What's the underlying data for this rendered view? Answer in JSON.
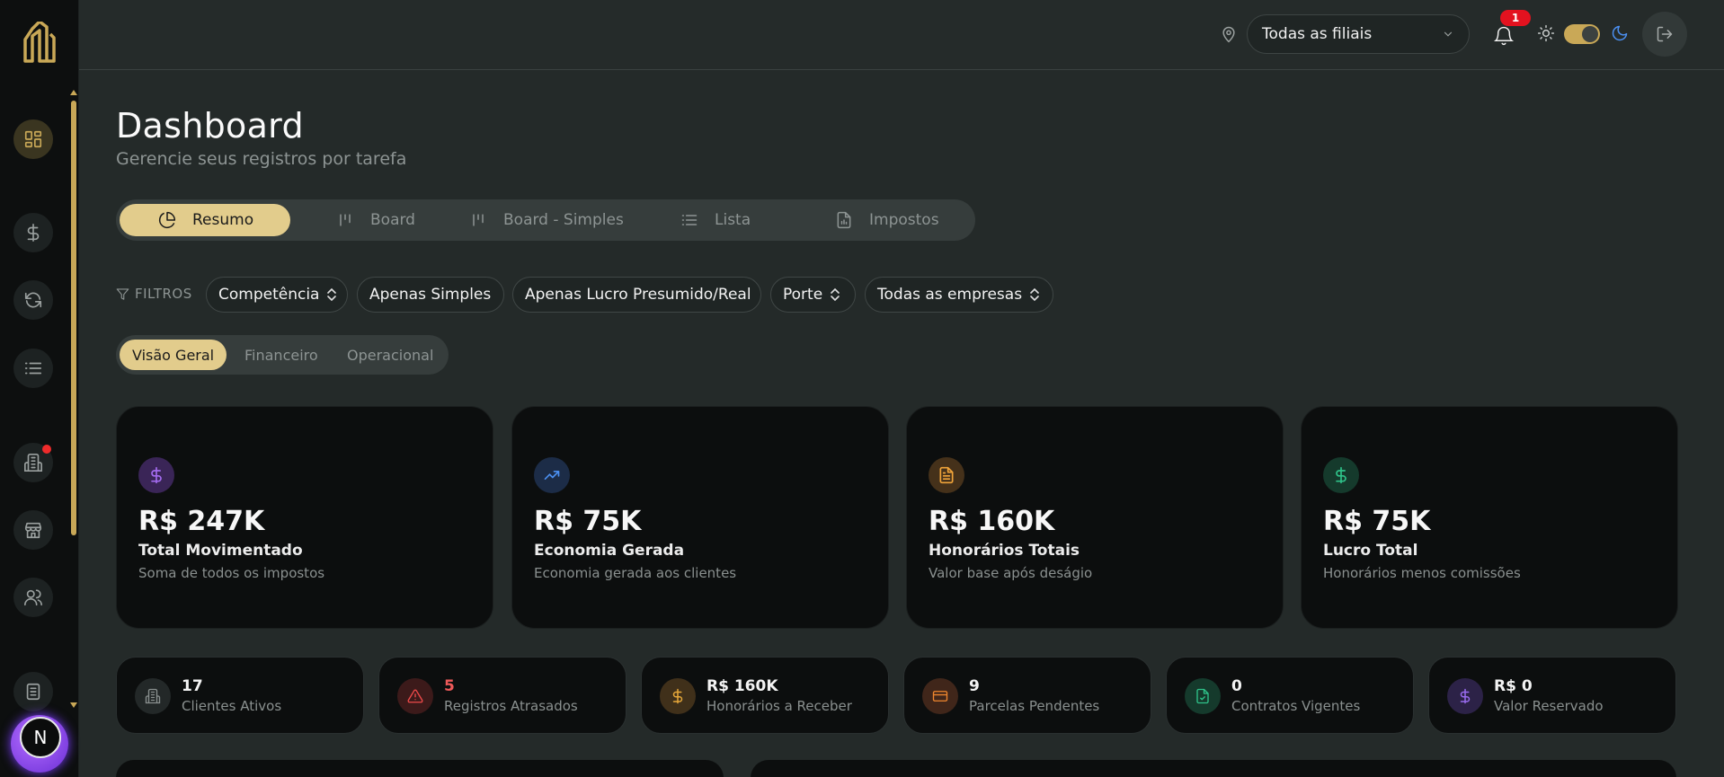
{
  "sidebar": {
    "avatar_initial": "N",
    "items": [
      {
        "name": "dashboard",
        "active": true
      },
      {
        "name": "financeiro"
      },
      {
        "name": "recorrencias"
      },
      {
        "name": "lista"
      },
      {
        "name": "empresas",
        "has_notification": true
      },
      {
        "name": "filiais"
      },
      {
        "name": "usuarios"
      },
      {
        "name": "relatorios"
      }
    ]
  },
  "topbar": {
    "branch_select": "Todas as filiais",
    "notification_count": "1"
  },
  "header": {
    "title": "Dashboard",
    "subtitle": "Gerencie seus registros por tarefa"
  },
  "view_tabs": [
    {
      "label": "Resumo",
      "icon": "pie-chart-icon",
      "active": true
    },
    {
      "label": "Board",
      "icon": "kanban-icon"
    },
    {
      "label": "Board - Simples",
      "icon": "kanban-icon"
    },
    {
      "label": "Lista",
      "icon": "list-icon"
    },
    {
      "label": "Impostos",
      "icon": "document-icon"
    }
  ],
  "filters": {
    "label": "FILTROS",
    "chips": [
      {
        "label": "Competência",
        "has_chevron": true
      },
      {
        "label": "Apenas Simples",
        "has_chevron": false
      },
      {
        "label": "Apenas Lucro Presumido/Real",
        "has_chevron": false
      },
      {
        "label": "Porte",
        "has_chevron": true
      },
      {
        "label": "Todas as empresas",
        "has_chevron": true
      }
    ]
  },
  "segments": [
    {
      "label": "Visão Geral",
      "active": true
    },
    {
      "label": "Financeiro"
    },
    {
      "label": "Operacional"
    }
  ],
  "kpis": [
    {
      "value": "R$ 247K",
      "label": "Total Movimentado",
      "desc": "Soma de todos os impostos",
      "icon": "dollar-icon",
      "color": "#a46cf0",
      "bg": "#3a2557"
    },
    {
      "value": "R$ 75K",
      "label": "Economia Gerada",
      "desc": "Economia gerada aos clientes",
      "icon": "trending-up-icon",
      "color": "#4b8ff0",
      "bg": "#1c2c47"
    },
    {
      "value": "R$ 160K",
      "label": "Honorários Totais",
      "desc": "Valor base após deságio",
      "icon": "file-text-icon",
      "color": "#f0a43a",
      "bg": "#45311a"
    },
    {
      "value": "R$ 75K",
      "label": "Lucro Total",
      "desc": "Honorários menos comissões",
      "icon": "dollar-icon",
      "color": "#2fc38a",
      "bg": "#153a2c"
    }
  ],
  "stats": [
    {
      "value": "17",
      "label": "Clientes Ativos",
      "icon": "building-icon",
      "color": "#8a908f",
      "bg": "#232828",
      "value_color": "#f3f3f3"
    },
    {
      "value": "5",
      "label": "Registros Atrasados",
      "icon": "alert-triangle-icon",
      "color": "#ef4a4a",
      "bg": "#3c1a1a",
      "value_color": "#ef5a5a"
    },
    {
      "value": "R$ 160K",
      "label": "Honorários a Receber",
      "icon": "dollar-icon",
      "color": "#e7a83a",
      "bg": "#40301a",
      "value_color": "#f3f3f3"
    },
    {
      "value": "9",
      "label": "Parcelas Pendentes",
      "icon": "credit-card-icon",
      "color": "#f0872e",
      "bg": "#40261a",
      "value_color": "#f3f3f3"
    },
    {
      "value": "0",
      "label": "Contratos Vigentes",
      "icon": "file-check-icon",
      "color": "#2fc38a",
      "bg": "#153a2c",
      "value_color": "#f3f3f3"
    },
    {
      "value": "R$ 0",
      "label": "Valor Reservado",
      "icon": "dollar-icon",
      "color": "#9a6cf0",
      "bg": "#2c2247",
      "value_color": "#f3f3f3"
    }
  ]
}
